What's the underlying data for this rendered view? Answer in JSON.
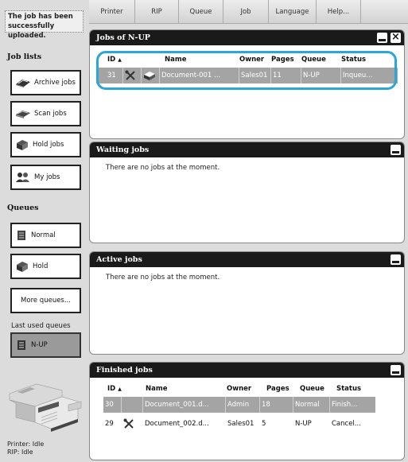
{
  "notice": "The job has been successfully uploaded.",
  "sidebar": {
    "job_lists_title": "Job lists",
    "job_lists": [
      {
        "label": "Archive jobs",
        "icon": "archive-icon"
      },
      {
        "label": "Scan jobs",
        "icon": "scan-icon"
      },
      {
        "label": "Hold jobs",
        "icon": "hold-icon"
      },
      {
        "label": "My jobs",
        "icon": "users-icon"
      }
    ],
    "queues_title": "Queues",
    "queues": [
      {
        "label": "Normal",
        "icon": "queue-icon"
      },
      {
        "label": "Hold",
        "icon": "hold-icon"
      }
    ],
    "more_queues": "More queues...",
    "last_used_title": "Last used queues",
    "last_used": [
      {
        "label": "N-UP",
        "icon": "queue-icon"
      }
    ],
    "status_printer": "Printer: Idle",
    "status_rip": "RIP: Idle"
  },
  "menu": [
    "Printer",
    "RIP",
    "Queue",
    "Job",
    "Language",
    "Help..."
  ],
  "columns": {
    "id": "ID",
    "name": "Name",
    "owner": "Owner",
    "pages": "Pages",
    "queue": "Queue",
    "status": "Status"
  },
  "panels": {
    "nup": {
      "title": "Jobs of N-UP",
      "rows": [
        {
          "id": "31",
          "name": "Document-001 ...",
          "owner": "Sales01",
          "pages": "11",
          "queue": "N-UP",
          "status": "Inqueu..."
        }
      ]
    },
    "waiting": {
      "title": "Waiting jobs",
      "message": "There are no jobs at the moment."
    },
    "active": {
      "title": "Active jobs",
      "message": "There are no jobs at the moment."
    },
    "finished": {
      "title": "Finished jobs",
      "rows": [
        {
          "id": "30",
          "name": "Document_001.d...",
          "owner": "Admin",
          "pages": "18",
          "queue": "Normal",
          "status": "Finish..."
        },
        {
          "id": "29",
          "name": "Document_002.d...",
          "owner": "Sales01",
          "pages": "5",
          "queue": "N-UP",
          "status": "Cancel..."
        }
      ]
    }
  },
  "colors": {
    "panel_title_bg": "#1a1a1a",
    "selected_row": "#a4a4a4",
    "highlight": "#2aa7d6"
  }
}
